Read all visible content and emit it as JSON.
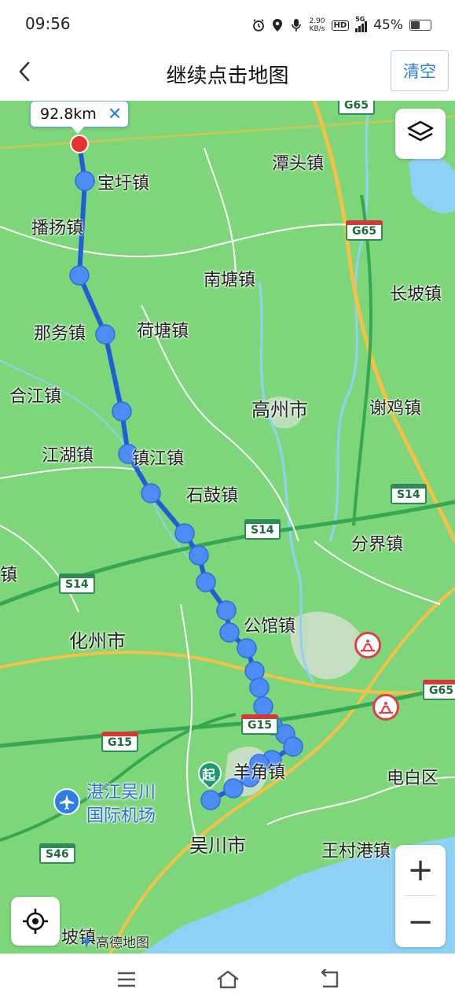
{
  "status_bar": {
    "time": "09:56",
    "net_speed_value": "2.90",
    "net_speed_unit": "KB/s",
    "hd_label": "HD",
    "network": "5G",
    "battery_percent_text": "45%",
    "battery_level": 0.45
  },
  "header": {
    "title": "继续点击地图",
    "clear_label": "清空",
    "back_icon": "chevron-left-icon"
  },
  "measurement": {
    "distance": "92.8km",
    "close_icon": "close-icon"
  },
  "map": {
    "places": {
      "tantou": "潭头镇",
      "baoyu": "宝圩镇",
      "boyang": "播扬镇",
      "nantang": "南塘镇",
      "changpo": "长坡镇",
      "nawu": "那务镇",
      "hetang": "荷塘镇",
      "hejiang": "合江镇",
      "gaozhou": "高州市",
      "xieji": "谢鸡镇",
      "jianghu": "江湖镇",
      "zhenjiang": "镇江镇",
      "shigu": "石鼓镇",
      "fenjie": "分界镇",
      "edge_zhen": "镇",
      "huazhou": "化州市",
      "gongguan": "公馆镇",
      "dianbai": "电白区",
      "airport_line1": "湛江吴川",
      "airport_line2": "国际机场",
      "wuchuan": "吴川市",
      "wangcungang": "王村港镇",
      "pozhen": "坡镇",
      "yangjiao": "羊角镇"
    },
    "highways": {
      "g65": "G65",
      "s14": "S14",
      "g15": "G15",
      "s46": "S46"
    },
    "start_marker": "起",
    "brand": "高德地图",
    "colors": {
      "land": "#7ed67a",
      "route": "#1f5fd6",
      "route_point": "#4d8cf5",
      "end_point": "#e8322f",
      "sea": "#8fd1f5",
      "start_marker": "#1d9a6c"
    }
  },
  "controls": {
    "layers_icon": "layers-icon",
    "zoom_in_label": "+",
    "zoom_out_label": "−",
    "locate_icon": "locate-icon"
  },
  "nav_bar": {
    "menu_icon": "menu-icon",
    "home_icon": "home-icon",
    "back_icon": "back-icon"
  }
}
